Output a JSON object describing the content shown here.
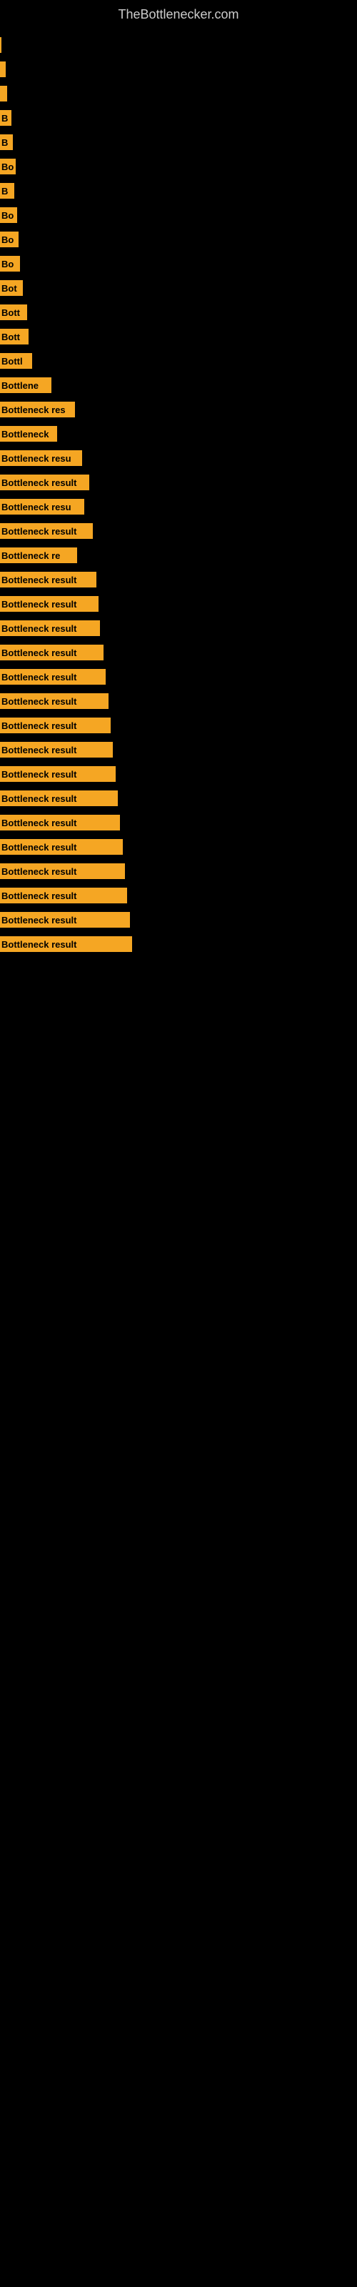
{
  "site": {
    "title": "TheBottlenecker.com"
  },
  "bars": [
    {
      "label": "",
      "width": 2
    },
    {
      "label": "",
      "width": 8
    },
    {
      "label": "",
      "width": 10
    },
    {
      "label": "B",
      "width": 16
    },
    {
      "label": "B",
      "width": 18
    },
    {
      "label": "Bo",
      "width": 22
    },
    {
      "label": "B",
      "width": 20
    },
    {
      "label": "Bo",
      "width": 24
    },
    {
      "label": "Bo",
      "width": 26
    },
    {
      "label": "Bo",
      "width": 28
    },
    {
      "label": "Bot",
      "width": 32
    },
    {
      "label": "Bott",
      "width": 38
    },
    {
      "label": "Bott",
      "width": 40
    },
    {
      "label": "Bottl",
      "width": 45
    },
    {
      "label": "Bottlene",
      "width": 72
    },
    {
      "label": "Bottleneck res",
      "width": 105
    },
    {
      "label": "Bottleneck",
      "width": 80
    },
    {
      "label": "Bottleneck resu",
      "width": 115
    },
    {
      "label": "Bottleneck result",
      "width": 125
    },
    {
      "label": "Bottleneck resu",
      "width": 118
    },
    {
      "label": "Bottleneck result",
      "width": 130
    },
    {
      "label": "Bottleneck re",
      "width": 108
    },
    {
      "label": "Bottleneck result",
      "width": 135
    },
    {
      "label": "Bottleneck result",
      "width": 138
    },
    {
      "label": "Bottleneck result",
      "width": 140
    },
    {
      "label": "Bottleneck result",
      "width": 145
    },
    {
      "label": "Bottleneck result",
      "width": 148
    },
    {
      "label": "Bottleneck result",
      "width": 152
    },
    {
      "label": "Bottleneck result",
      "width": 155
    },
    {
      "label": "Bottleneck result",
      "width": 158
    },
    {
      "label": "Bottleneck result",
      "width": 162
    },
    {
      "label": "Bottleneck result",
      "width": 165
    },
    {
      "label": "Bottleneck result",
      "width": 168
    },
    {
      "label": "Bottleneck result",
      "width": 172
    },
    {
      "label": "Bottleneck result",
      "width": 175
    },
    {
      "label": "Bottleneck result",
      "width": 178
    },
    {
      "label": "Bottleneck result",
      "width": 182
    },
    {
      "label": "Bottleneck result",
      "width": 185
    }
  ]
}
